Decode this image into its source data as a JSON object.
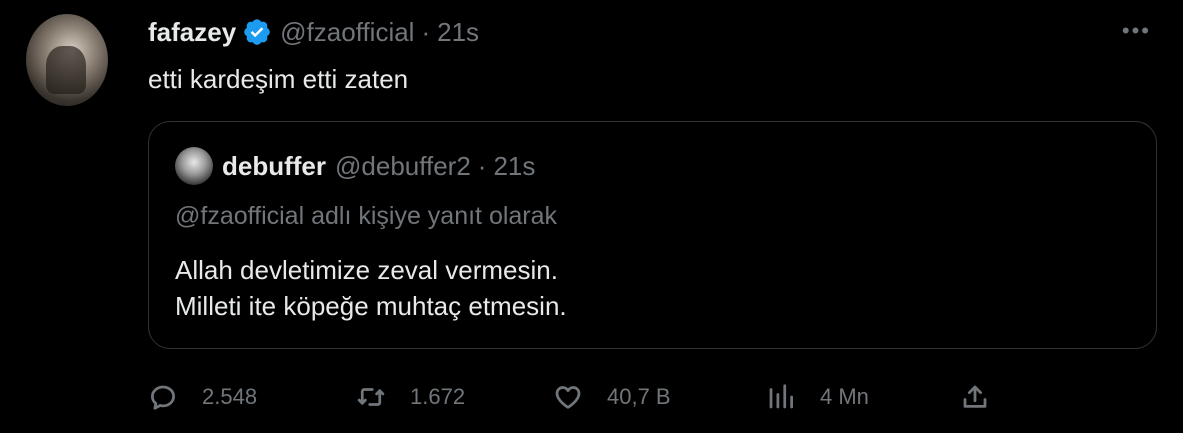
{
  "tweet": {
    "author_name": "fafazey",
    "author_handle": "@fzaofficial",
    "separator": "·",
    "time": "21s",
    "text": "etti kardeşim etti zaten",
    "more_label": "•••"
  },
  "quote": {
    "author_name": "debuffer",
    "author_handle": "@debuffer2",
    "separator": "·",
    "time": "21s",
    "reply_to": "@fzaofficial adlı kişiye yanıt olarak",
    "line1": "Allah devletimize zeval vermesin.",
    "line2": "Milleti ite köpeğe muhtaç etmesin."
  },
  "actions": {
    "replies": "2.548",
    "retweets": "1.672",
    "likes": "40,7 B",
    "views": "4 Mn"
  },
  "icons": [
    "verified-badge-icon",
    "more-icon",
    "reply-icon",
    "retweet-icon",
    "like-icon",
    "views-icon",
    "share-icon"
  ],
  "colors": {
    "background": "#000000",
    "text": "#e7e9ea",
    "muted": "#71767b",
    "verified": "#1d9bf0",
    "border": "#2f3336"
  }
}
